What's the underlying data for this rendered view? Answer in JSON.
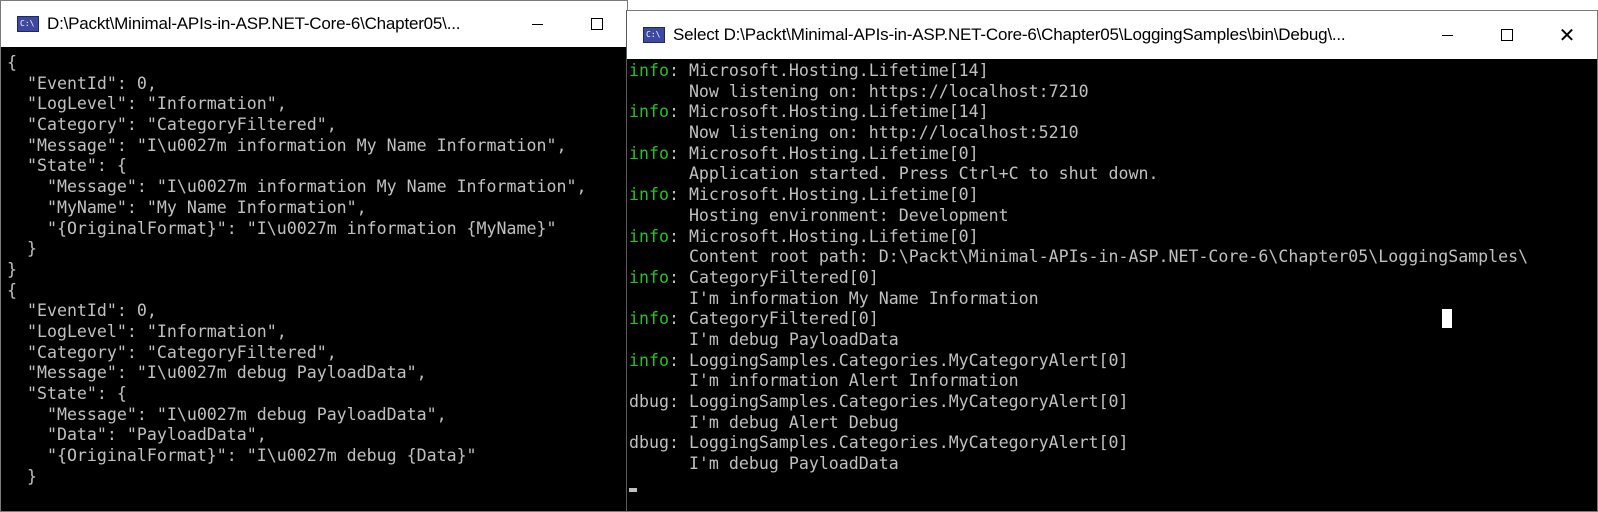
{
  "left_window": {
    "title": "D:\\Packt\\Minimal-APIs-in-ASP.NET-Core-6\\Chapter05\\...",
    "lines": [
      "{",
      "  \"EventId\": 0,",
      "  \"LogLevel\": \"Information\",",
      "  \"Category\": \"CategoryFiltered\",",
      "  \"Message\": \"I\\u0027m information My Name Information\",",
      "  \"State\": {",
      "    \"Message\": \"I\\u0027m information My Name Information\",",
      "    \"MyName\": \"My Name Information\",",
      "    \"{OriginalFormat}\": \"I\\u0027m information {MyName}\"",
      "  }",
      "}",
      "{",
      "  \"EventId\": 0,",
      "  \"LogLevel\": \"Information\",",
      "  \"Category\": \"CategoryFiltered\",",
      "  \"Message\": \"I\\u0027m debug PayloadData\",",
      "  \"State\": {",
      "    \"Message\": \"I\\u0027m debug PayloadData\",",
      "    \"Data\": \"PayloadData\",",
      "    \"{OriginalFormat}\": \"I\\u0027m debug {Data}\"",
      "  }"
    ]
  },
  "right_window": {
    "title": "Select D:\\Packt\\Minimal-APIs-in-ASP.NET-Core-6\\Chapter05\\LoggingSamples\\bin\\Debug\\...",
    "lines": [
      {
        "level": "info",
        "text": ": Microsoft.Hosting.Lifetime[14]"
      },
      {
        "level": "",
        "text": "      Now listening on: https://localhost:7210"
      },
      {
        "level": "info",
        "text": ": Microsoft.Hosting.Lifetime[14]"
      },
      {
        "level": "",
        "text": "      Now listening on: http://localhost:5210"
      },
      {
        "level": "info",
        "text": ": Microsoft.Hosting.Lifetime[0]"
      },
      {
        "level": "",
        "text": "      Application started. Press Ctrl+C to shut down."
      },
      {
        "level": "info",
        "text": ": Microsoft.Hosting.Lifetime[0]"
      },
      {
        "level": "",
        "text": "      Hosting environment: Development"
      },
      {
        "level": "info",
        "text": ": Microsoft.Hosting.Lifetime[0]"
      },
      {
        "level": "",
        "text": "      Content root path: D:\\Packt\\Minimal-APIs-in-ASP.NET-Core-6\\Chapter05\\LoggingSamples\\"
      },
      {
        "level": "info",
        "text": ": CategoryFiltered[0]"
      },
      {
        "level": "",
        "text": "      I'm information My Name Information"
      },
      {
        "level": "info",
        "text": ": CategoryFiltered[0]"
      },
      {
        "level": "",
        "text": "      I'm debug PayloadData"
      },
      {
        "level": "info",
        "text": ": LoggingSamples.Categories.MyCategoryAlert[0]"
      },
      {
        "level": "",
        "text": "      I'm information Alert Information"
      },
      {
        "level": "dbug",
        "text": ": LoggingSamples.Categories.MyCategoryAlert[0]"
      },
      {
        "level": "",
        "text": "      I'm debug Alert Debug"
      },
      {
        "level": "dbug",
        "text": ": LoggingSamples.Categories.MyCategoryAlert[0]"
      },
      {
        "level": "",
        "text": "      I'm debug PayloadData"
      }
    ]
  },
  "icons": {
    "app": "console-app-icon",
    "minimize": "minimize-icon",
    "maximize": "maximize-icon",
    "close": "close-icon"
  },
  "colors": {
    "console_bg": "#000000",
    "console_text": "#c0c0c0",
    "info_level": "#22c322",
    "titlebar_bg": "#ffffff"
  }
}
